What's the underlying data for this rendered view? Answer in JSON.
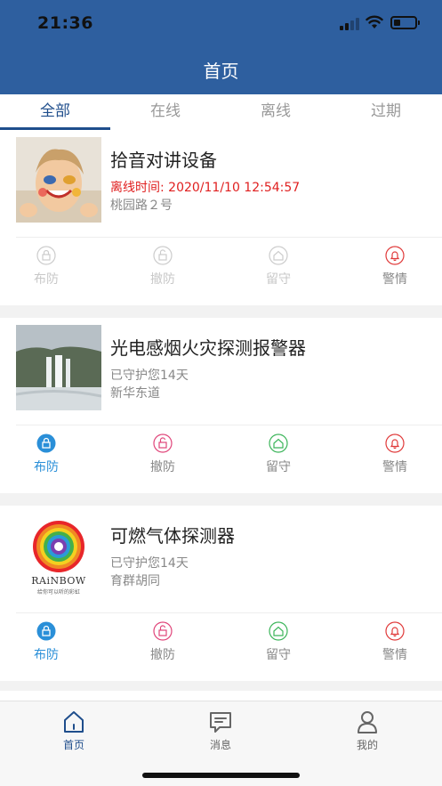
{
  "status_bar": {
    "time": "21:36"
  },
  "header": {
    "title": "首页"
  },
  "tabs": [
    {
      "label": "全部"
    },
    {
      "label": "在线"
    },
    {
      "label": "离线"
    },
    {
      "label": "过期"
    }
  ],
  "devices": [
    {
      "name": "拾音对讲设备",
      "status": "离线时间: 2020/11/10 12:54:57",
      "address": "桃园路２号",
      "actions": [
        "布防",
        "撤防",
        "留守",
        "警情"
      ]
    },
    {
      "name": "光电感烟火灾探测报警器",
      "status": "已守护您14天",
      "address": "新华东道",
      "actions": [
        "布防",
        "撤防",
        "留守",
        "警情"
      ]
    },
    {
      "name": "可燃气体探测器",
      "status": "已守护您14天",
      "address": "育群胡同",
      "logo_text": "RAiNBOW",
      "logo_sub": "给你可以听的彩虹",
      "actions": [
        "布防",
        "撤防",
        "留守",
        "警情"
      ]
    }
  ],
  "bottom_nav": [
    {
      "label": "首页"
    },
    {
      "label": "消息"
    },
    {
      "label": "我的"
    }
  ],
  "colors": {
    "header": "#2e5f9f",
    "active_tab": "#1f4e8c",
    "alert": "#e02020",
    "arm": "#2a8fd8",
    "disarm": "#e0457a",
    "stay": "#3cb55a",
    "alarm": "#e03a3a"
  }
}
